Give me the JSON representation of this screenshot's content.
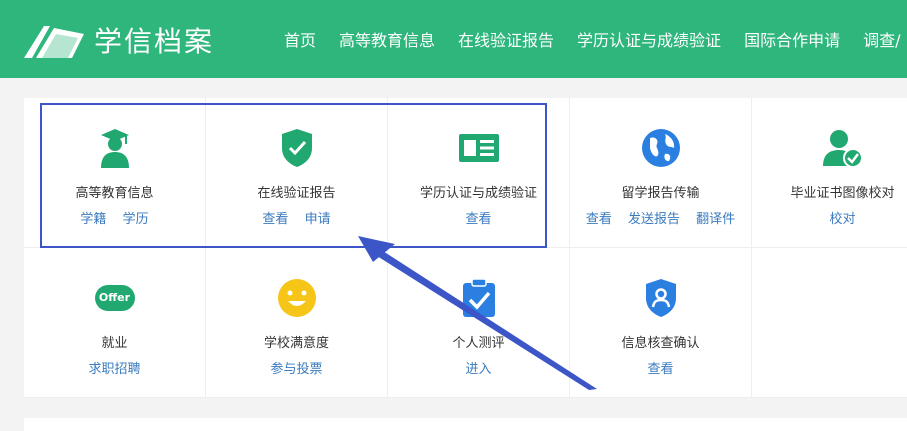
{
  "header": {
    "logo_text": "学信档案",
    "nav": [
      "首页",
      "高等教育信息",
      "在线验证报告",
      "学历认证与成绩验证",
      "国际合作申请",
      "调查/"
    ]
  },
  "services": [
    {
      "title": "高等教育信息",
      "icon": "graduate-icon",
      "links": [
        "学籍",
        "学历"
      ]
    },
    {
      "title": "在线验证报告",
      "icon": "shield-check-icon",
      "links": [
        "查看",
        "申请"
      ]
    },
    {
      "title": "学历认证与成绩验证",
      "icon": "id-card-icon",
      "links": [
        "查看"
      ]
    },
    {
      "title": "留学报告传输",
      "icon": "globe-icon",
      "links": [
        "查看",
        "发送报告",
        "翻译件"
      ]
    },
    {
      "title": "毕业证书图像校对",
      "icon": "user-check-icon",
      "links": [
        "校对"
      ]
    },
    {
      "title": "就业",
      "icon": "offer-icon",
      "icon_text": "Offer",
      "links": [
        "求职招聘"
      ]
    },
    {
      "title": "学校满意度",
      "icon": "smiley-icon",
      "links": [
        "参与投票"
      ]
    },
    {
      "title": "个人测评",
      "icon": "clipboard-check-icon",
      "links": [
        "进入"
      ]
    },
    {
      "title": "信息核查确认",
      "icon": "shield-user-icon",
      "links": [
        "查看"
      ]
    }
  ],
  "colors": {
    "brand_green": "#2fb67c",
    "icon_green": "#21a870",
    "icon_blue": "#2b7fe0",
    "icon_yellow": "#f5c518",
    "link_blue": "#3a7bbf",
    "annotation_blue": "#3c56c7"
  }
}
